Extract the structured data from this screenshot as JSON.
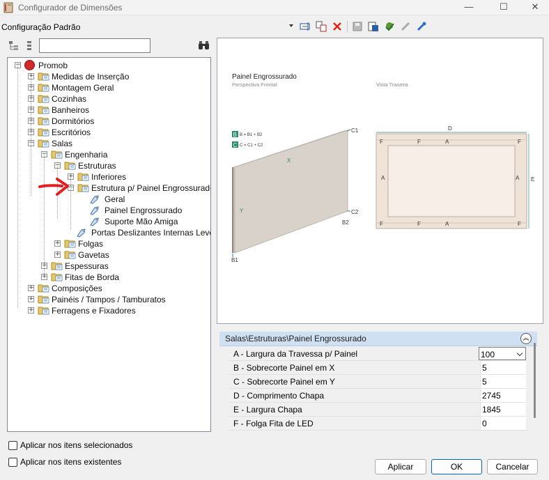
{
  "window": {
    "title": "Configurador de Dimensões",
    "min_glyph": "—",
    "max_glyph": "☐",
    "close_glyph": "✕"
  },
  "toolbar": {
    "configuration": "Configuração Padrão",
    "icons": [
      "rename-icon",
      "copy-config-icon",
      "delete-icon",
      "save-icon",
      "export-icon",
      "apply-icon",
      "connect-icon",
      "tools-icon"
    ]
  },
  "tree": {
    "search_value": "",
    "items": [
      {
        "label": "Promob"
      },
      {
        "label": "Medidas de Inserção"
      },
      {
        "label": "Montagem Geral"
      },
      {
        "label": "Cozinhas"
      },
      {
        "label": "Banheiros"
      },
      {
        "label": "Dormitórios"
      },
      {
        "label": "Escritórios"
      },
      {
        "label": "Salas"
      },
      {
        "label": "Engenharia"
      },
      {
        "label": "Estruturas"
      },
      {
        "label": "Inferiores"
      },
      {
        "label": "Estrutura p/ Painel Engrossurado"
      },
      {
        "label": "Geral"
      },
      {
        "label": "Painel Engrossurado"
      },
      {
        "label": "Suporte Mão Amiga"
      },
      {
        "label": "Portas Deslizantes Internas Leves"
      },
      {
        "label": "Folgas"
      },
      {
        "label": "Gavetas"
      },
      {
        "label": "Espessuras"
      },
      {
        "label": "Fitas de Borda"
      },
      {
        "label": "Composições"
      },
      {
        "label": "Painéis / Tampos / Tamburatos"
      },
      {
        "label": "Ferragens e Fixadores"
      }
    ]
  },
  "options": {
    "apply_selected": "Aplicar nos itens selecionados",
    "apply_existing": "Aplicar nos itens existentes"
  },
  "preview": {
    "title": "Painel Engrossurado",
    "front_label": "Perspectiva Frontal",
    "back_label": "Vista Traseira",
    "legend_b": "B = B1 + B2",
    "legend_c": "C = C1 + C2",
    "marks": {
      "B": "B",
      "C": "C",
      "X": "X",
      "Y": "Y",
      "B1": "B1",
      "B2": "B2",
      "C1": "C1",
      "C2": "C2",
      "D": "D",
      "E": "E",
      "A": "A",
      "F": "F"
    },
    "colors": {
      "accent": "#2a8a6e",
      "panel": "#d9d2cb",
      "back": "#efe3d8"
    }
  },
  "properties": {
    "path": "Salas\\Estruturas\\Painel Engrossurado",
    "collapse_glyph": "︽",
    "rows": [
      {
        "name": "A - Largura da Travessa p/ Painel",
        "value": "100"
      },
      {
        "name": "B - Sobrecorte Painel em X",
        "value": "5"
      },
      {
        "name": "C - Sobrecorte Painel em Y",
        "value": "5"
      },
      {
        "name": "D - Comprimento Chapa",
        "value": "2745"
      },
      {
        "name": "E - Largura Chapa",
        "value": "1845"
      },
      {
        "name": "F - Folga Fita de LED",
        "value": "0"
      }
    ]
  },
  "buttons": {
    "apply": "Aplicar",
    "ok": "OK",
    "cancel": "Cancelar"
  }
}
